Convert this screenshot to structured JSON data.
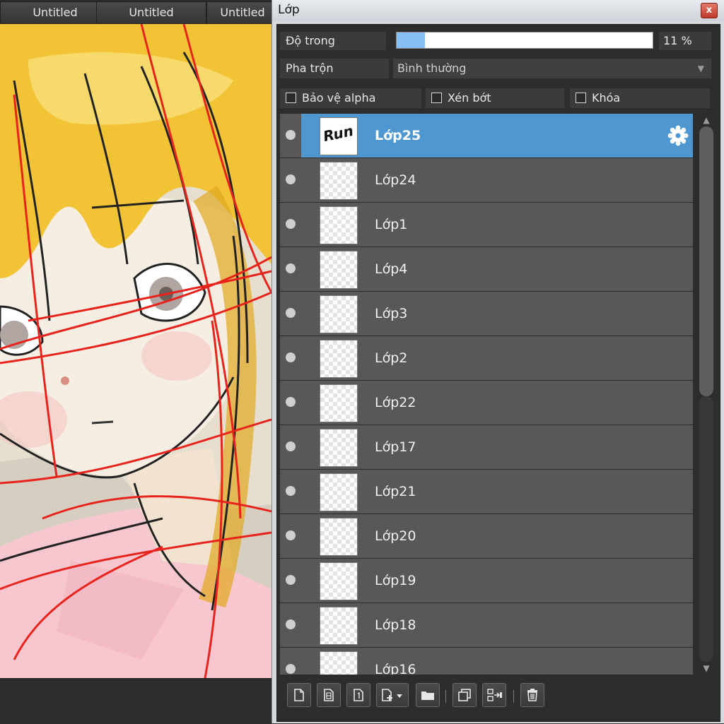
{
  "tabs": [
    "Untitled",
    "Untitled",
    "Untitled"
  ],
  "panel": {
    "title": "Lớp",
    "close_label": "x",
    "opacity_label": "Độ trong",
    "opacity_value": "11 %",
    "opacity_fraction": 0.11,
    "blend_label": "Pha trộn",
    "blend_value": "Bình thường",
    "protect_alpha": "Bảo vệ alpha",
    "clipping": "Xén bớt",
    "lock": "Khóa"
  },
  "layers": [
    {
      "name": "Lớp25",
      "selected": true
    },
    {
      "name": "Lớp24"
    },
    {
      "name": "Lớp1"
    },
    {
      "name": "Lớp4"
    },
    {
      "name": "Lớp3"
    },
    {
      "name": "Lớp2"
    },
    {
      "name": "Lớp22"
    },
    {
      "name": "Lớp17"
    },
    {
      "name": "Lớp21"
    },
    {
      "name": "Lớp20"
    },
    {
      "name": "Lớp19"
    },
    {
      "name": "Lớp18"
    },
    {
      "name": "Lớp16"
    }
  ],
  "thumb_text": "Run",
  "colors": {
    "selected_row": "#4e97d0",
    "opacity_fill": "#86bff4",
    "sketch_red": "#e8231c",
    "hair": "#f2c335"
  },
  "toolbar_icons": [
    "new-layer-icon",
    "new-8bit-layer-icon",
    "new-1bit-layer-icon",
    "add-layer-menu-icon",
    "folder-icon",
    "duplicate-layer-icon",
    "merge-down-icon",
    "trash-icon"
  ]
}
